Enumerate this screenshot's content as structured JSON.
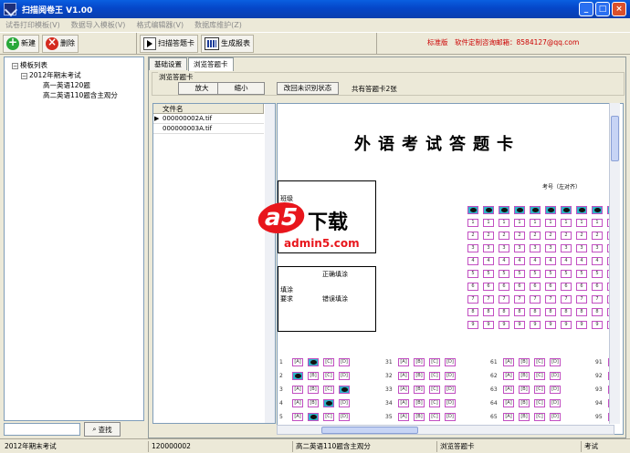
{
  "window": {
    "title": "扫描阅卷王 V1.00",
    "min": "_",
    "max": "□",
    "close": "×"
  },
  "menu": [
    "试卷打印模板(V)",
    "数据导入模板(V)",
    "格式编辑器(V)",
    "数据库维护(Z)"
  ],
  "toolbar": {
    "new": "新建",
    "delete": "删除",
    "scan": "扫描答题卡",
    "report": "生成报表"
  },
  "contact": "标准版　软件定制咨询邮箱：8584127@qq.com",
  "tree": {
    "root": "模板列表",
    "exam": "2012年期末考试",
    "items": [
      "高一英语120题",
      "高二英语110题含主观分"
    ]
  },
  "search": {
    "button": "查找",
    "value": ""
  },
  "tabs": [
    "基础设置",
    "浏览答题卡"
  ],
  "browse": {
    "group": "浏览答题卡",
    "zoom_in": "放大",
    "zoom_out": "缩小",
    "fix": "改回未识别状态",
    "count": "共有答题卡2张"
  },
  "files": {
    "header": "文件名",
    "rows": [
      "000000002A.tif",
      "000000003A.tif"
    ]
  },
  "sheet": {
    "title": "外语考试答题卡",
    "class_label": "班级",
    "exam_no_label": "考号（左对齐）",
    "correct_label": "正确填涂",
    "wrong_label": "错误填涂",
    "fill_label": "填涂要求"
  },
  "watermark": {
    "logo": "a5",
    "text": "下载",
    "site": "admin5.com"
  },
  "status": [
    "2012年期末考试",
    "120000002",
    "高二英语110题含主观分",
    "浏览答题卡",
    "考试"
  ]
}
